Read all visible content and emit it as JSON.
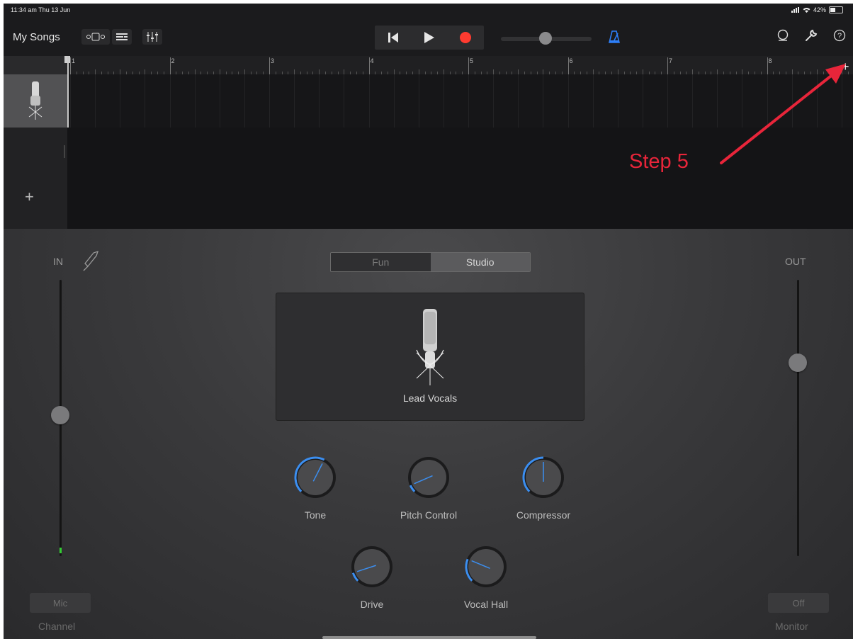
{
  "status_bar": {
    "time": "11:34 am  Thu 13 Jun",
    "battery": "42%"
  },
  "toolbar": {
    "my_songs": "My Songs"
  },
  "ruler": {
    "bars": [
      "1",
      "2",
      "3",
      "4",
      "5",
      "6",
      "7",
      "8"
    ]
  },
  "track": {
    "name": "Lead Vocals"
  },
  "annotation": {
    "text": "Step 5"
  },
  "panel": {
    "in_label": "IN",
    "out_label": "OUT",
    "segments": {
      "fun": "Fun",
      "studio": "Studio",
      "selected": "Studio"
    },
    "instrument_name": "Lead Vocals",
    "knobs": [
      {
        "name": "Tone",
        "value": 0.6
      },
      {
        "name": "Pitch Control",
        "value": 0.08
      },
      {
        "name": "Compressor",
        "value": 0.5
      },
      {
        "name": "Drive",
        "value": 0.1
      },
      {
        "name": "Vocal Hall",
        "value": 0.25
      }
    ],
    "input_level": 0.5,
    "output_level": 0.7,
    "channel_button": "Mic",
    "channel_label": "Channel",
    "monitor_button": "Off",
    "monitor_label": "Monitor"
  },
  "colors": {
    "record": "#ff3b30",
    "accent": "#3b8ef0",
    "annotation": "#e8253a",
    "metronome": "#2d7ff9"
  }
}
